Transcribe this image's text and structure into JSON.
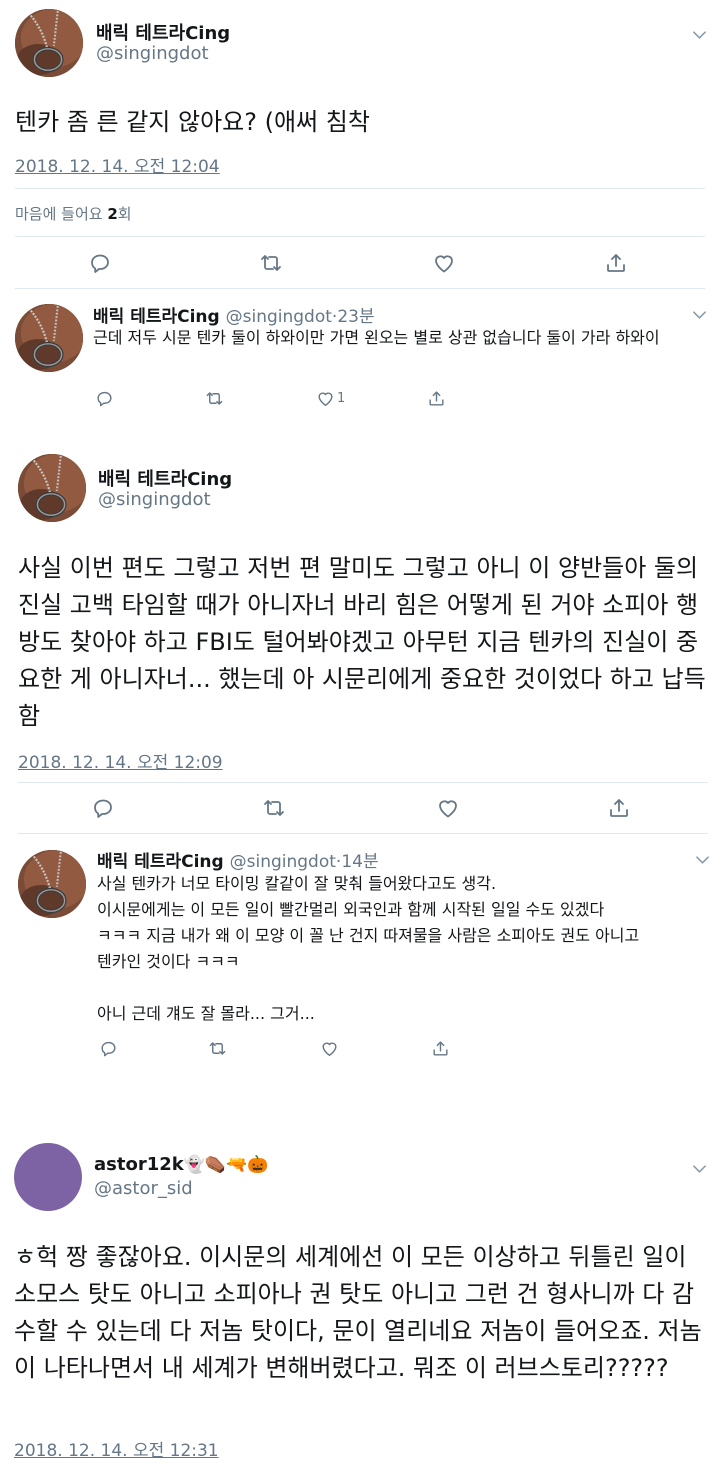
{
  "tweet1": {
    "name": "배릭 테트라Cing",
    "handle": "@singingdot",
    "text": "텐카 좀 른 같지 않아요? (애써 침착",
    "timestamp": "2018. 12. 14. 오전 12:04",
    "likes_prefix": "마음에 들어요 ",
    "likes_count": "2",
    "likes_suffix": "회"
  },
  "reply1": {
    "name": "배릭 테트라Cing",
    "handle": "@singingdot",
    "age": "·23분",
    "text": "근데 저두 시문 텐카 둘이 하와이만 가면 왼오는 별로 상관 없습니다 둘이 가라 하와이",
    "like_count": "1"
  },
  "tweet2": {
    "name": "배릭 테트라Cing",
    "handle": "@singingdot",
    "text": "사실 이번 편도 그렇고 저번 편 말미도 그렇고 아니 이 양반들아 둘의 진실 고백 타임할 때가 아니자너 바리 힘은 어떻게 된 거야 소피아 행방도 찾아야 하고 FBI도 털어봐야겠고 아무턴 지금 텐카의 진실이 중요한 게 아니자너... 했는데 아 시문리에게 중요한 것이었다 하고 납득함",
    "timestamp": "2018. 12. 14. 오전 12:09"
  },
  "reply2": {
    "name": "배릭 테트라Cing",
    "handle": "@singingdot",
    "age": "·14분",
    "lines": [
      "사실 텐카가 너모 타이밍 칼같이 잘 맞춰 들어왔다고도 생각.",
      "이시문에게는 이 모든 일이 빨간멀리 외국인과 함께 시작된 일일 수도 있겠다",
      "ㅋㅋㅋ 지금 내가 왜 이 모양 이 꼴 난 건지 따져물을 사람은 소피아도 권도 아니고",
      "텐카인 것이다 ㅋㅋㅋ",
      "",
      "아니 근데 걔도 잘 몰라... 그거..."
    ]
  },
  "tweet3": {
    "name": "astor12k",
    "name_emojis": "👻⚰️🔫🎃",
    "handle": "@astor_sid",
    "avatar_color": "#7e63a4",
    "text": "ㅎ헉 짱 좋잖아요. 이시문의 세계에선 이 모든 이상하고 뒤틀린 일이 소모스 탓도 아니고 소피아나 권 탓도 아니고 그런 건 형사니까 다 감수할 수 있는데 다 저놈 탓이다, 문이 열리네요 저놈이 들어오죠. 저놈이 나타나면서 내 세계가 변해버렸다고. 뭐조 이 러브스토리?????",
    "timestamp": "2018. 12. 14. 오전 12:31"
  },
  "icons": {
    "reply": "reply-icon",
    "retweet": "retweet-icon",
    "like": "heart-icon",
    "share": "share-icon",
    "menu": "chevron-down-icon"
  },
  "colors": {
    "text": "#14171a",
    "secondary": "#657786",
    "divider": "#e1e8ed"
  }
}
